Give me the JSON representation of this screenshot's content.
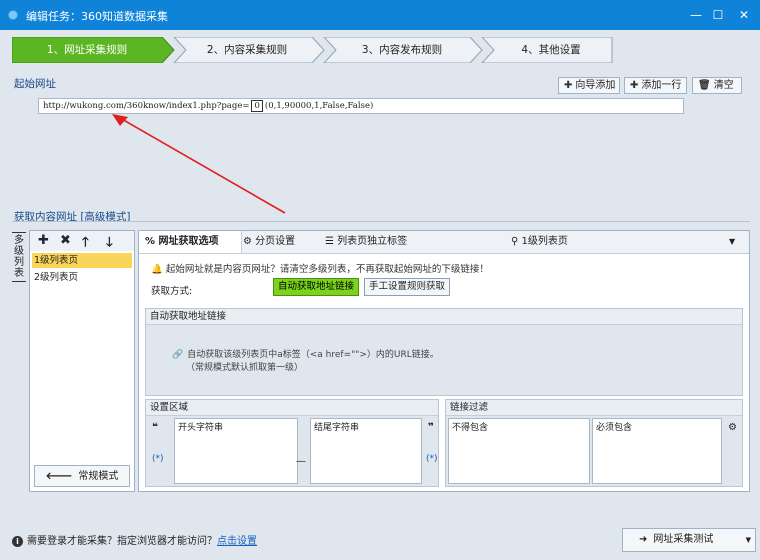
{
  "window": {
    "title": "编辑任务：360知道数据采集",
    "controls": [
      "—",
      "☐",
      "✕"
    ]
  },
  "steps": [
    {
      "label": "1、网址采集规则",
      "active": true
    },
    {
      "label": "2、内容采集规则",
      "active": false
    },
    {
      "label": "3、内容发布规则",
      "active": false
    },
    {
      "label": "4、其他设置",
      "active": false
    }
  ],
  "start_url": {
    "section_label": "起始网址",
    "value": "http://wukong.com/360know/index1.php?page=",
    "param_marker": "0",
    "param_rest": "(0,1,90000,1,False,False)",
    "buttons": {
      "wizard_add": "向导添加",
      "add_row": "添加一行",
      "clear": "清空"
    }
  },
  "content_urls": {
    "section_label": "获取内容网址 [高级模式]",
    "vertical_label": [
      "多",
      "级",
      "列",
      "表"
    ],
    "list_items": [
      "1级列表页",
      "2级列表页"
    ],
    "normal_mode_button": "常规模式"
  },
  "tabs": {
    "url_options": "网址获取选项",
    "paging": "分页设置",
    "list_tag": "列表页独立标签",
    "level_selector": "1级列表页"
  },
  "url_options": {
    "notice": "起始网址就是内容页网址？请清空多级列表，不再获取起始网址的下级链接！",
    "method_label": "获取方式:",
    "auto_button": "自动获取地址链接",
    "manual_button": "手工设置规则获取",
    "auto_group_label": "自动获取地址链接",
    "auto_desc_line1": "自动获取该级列表页中a标签（<a href=\"\">）内的URL链接。",
    "auto_desc_line2": "（常规模式默认抓取第一级）"
  },
  "settings_area": {
    "label": "设置区域",
    "start_placeholder": "开头字符串",
    "end_placeholder": "结尾字符串",
    "wildcard_left": "(*)",
    "wildcard_right": "(*)",
    "dash": "—"
  },
  "link_filter": {
    "label": "链接过滤",
    "exclude_placeholder": "不得包含",
    "include_placeholder": "必须包含"
  },
  "footer": {
    "question": "需要登录才能采集？指定浏览器才能访问？",
    "link": "点击设置",
    "test_button": "网址采集测试"
  }
}
